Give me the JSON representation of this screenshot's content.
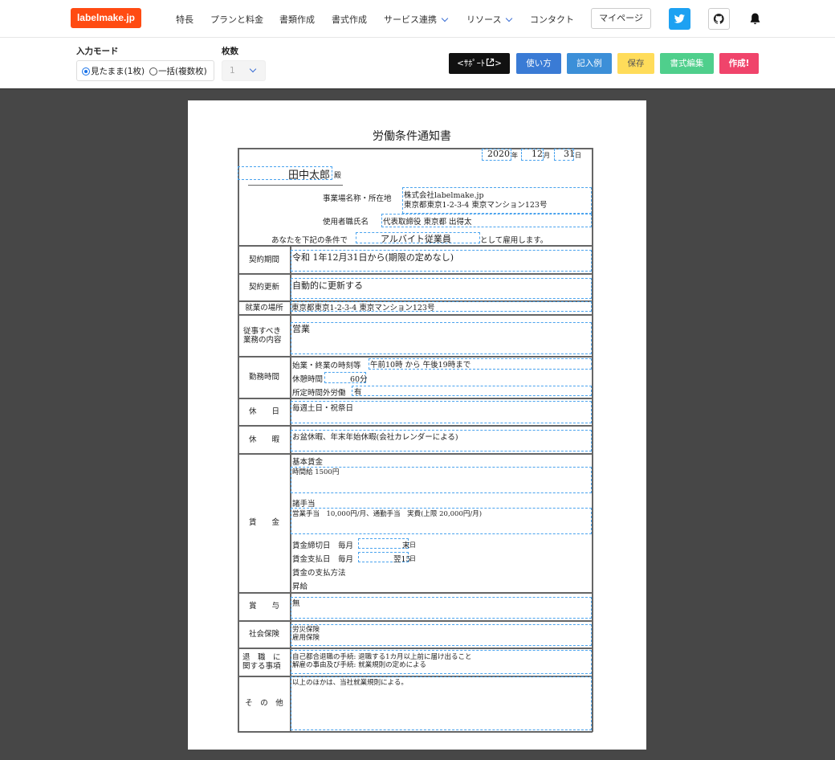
{
  "header": {
    "logo": "labelmake.jp",
    "nav": [
      "特長",
      "プランと料金",
      "書類作成",
      "書式作成",
      "サービス連携",
      "リソース",
      "コンタクト"
    ],
    "mypage": "マイページ"
  },
  "controls": {
    "mode_label": "入力モード",
    "mode_option_single": "見たまま(1枚)",
    "mode_option_bulk": "一括(複数枚)",
    "count_label": "枚数",
    "count_value": "1",
    "support": "<ｻﾎﾟｰﾄ",
    "howto": "使い方",
    "example": "記入例",
    "save": "保存",
    "edit_format": "書式編集",
    "create": "作成!"
  },
  "doc": {
    "title": "労働条件通知書",
    "year": "2020",
    "year_unit": "年",
    "month": "12",
    "month_unit": "月",
    "day": "31",
    "day_unit": "日",
    "employee_name": "田中太郎",
    "honorific": "殿",
    "workplace_label": "事業場名称・所在地",
    "company_name": "株式会社labelmake.jp",
    "company_address": "東京都東京1-2-3-4 東京マンション123号",
    "employer_label": "使用者職氏名",
    "employer_name": "代表取締役 東京都 出得太",
    "intro_pre": "あなたを下記の条件で",
    "employment_type": "アルバイト従業員",
    "intro_post": "として雇用します。",
    "rows": {
      "contract_period": "契約期間",
      "renewal": "契約更新",
      "work_place": "就業の場所",
      "duties": "従事すべき業務の内容",
      "work_hours": "勤務時間",
      "holidays": "休　　日",
      "vacation": "休　　暇",
      "wages": "賃　　金",
      "bonus": "賞　　与",
      "social_insurance": "社会保険",
      "retirement": "退　職　に関する事項",
      "other": "そ　の　他"
    },
    "values": {
      "contract_period": "令和 1年12月31日から(期限の定めなし)",
      "renewal": "自動的に更新する",
      "work_place": "東京都東京1-2-3-4 東京マンション123号",
      "duties": "営業",
      "start_end_label": "始業・終業の時刻等",
      "start_end": "午前10時 から 午後19時まで",
      "break_label": "休憩時間",
      "break_value": "60分",
      "overtime_label": "所定時間外労働",
      "overtime_value": "有",
      "holidays": "毎週土日・祝祭日",
      "vacation": "お盆休暇、年末年始休暇(会社カレンダーによる)",
      "base_wage_label": "基本賃金",
      "base_wage": "時間給 1500円",
      "allowance_label": "諸手当",
      "allowance": "営業手当　10,000円/月、通勤手当　実費(上限 20,000円/月)",
      "closing_label": "賃金締切日　毎月",
      "closing_value": "末",
      "pay_label": "賃金支払日　毎月",
      "pay_value": "翌15",
      "day_suffix": "日",
      "payment_method_label": "賃金の支払方法",
      "raise_label": "昇給",
      "bonus": "無",
      "insurance_1": "労災保険",
      "insurance_2": "雇用保険",
      "retirement_1": "自己都合退職の手続: 退職する1カ月以上前に届け出ること",
      "retirement_2": "解雇の事由及び手続: 就業規則の定めによる",
      "other": "以上のほかは、当社就業規則による。"
    }
  }
}
